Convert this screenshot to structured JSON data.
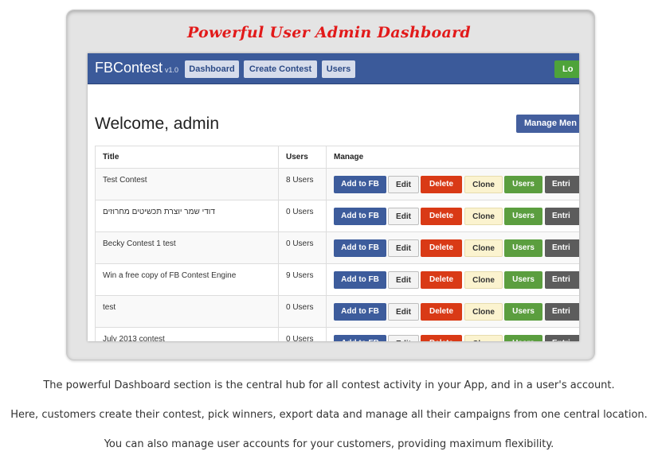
{
  "headline": "Powerful User Admin Dashboard",
  "app": {
    "brand": "FBContest",
    "version": "v1.0",
    "nav": [
      "Dashboard",
      "Create Contest",
      "Users"
    ],
    "login_label": "Lo",
    "welcome": "Welcome, admin",
    "manage_menu": "Manage Men",
    "table": {
      "headers": [
        "Title",
        "Users",
        "Manage"
      ],
      "rows": [
        {
          "title": "Test Contest",
          "users": "8 Users"
        },
        {
          "title": "דודי שמר יוצרת תכשיטים מחרוזים",
          "users": "0 Users"
        },
        {
          "title": "Becky Contest 1 test",
          "users": "0 Users"
        },
        {
          "title": "Win a free copy of FB Contest Engine",
          "users": "9 Users"
        },
        {
          "title": "test",
          "users": "0 Users"
        },
        {
          "title": "July 2013 contest",
          "users": "0 Users"
        }
      ],
      "buttons": {
        "add": "Add to FB",
        "edit": "Edit",
        "delete": "Delete",
        "clone": "Clone",
        "users": "Users",
        "entries": "Entri"
      }
    }
  },
  "captions": [
    "The powerful Dashboard section is the central hub for all contest activity in your App, and in a user's account.",
    "Here, customers create their contest, pick winners, export data and manage all their campaigns from one central location.",
    "You can also manage user accounts for your customers, providing maximum flexibility."
  ],
  "colors": {
    "headline": "#e21a1a",
    "navbar": "#3b5a9a",
    "add_button": "#3d5c9c",
    "delete_button": "#d93a16",
    "clone_button": "#fbf3cf",
    "users_button": "#5b9e3f",
    "entries_button": "#5c5c5c"
  }
}
